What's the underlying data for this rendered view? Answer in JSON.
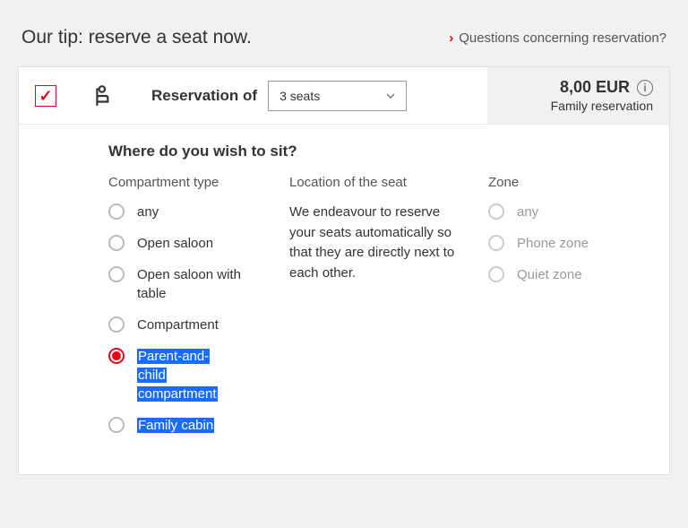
{
  "tip_title": "Our tip: reserve a seat now.",
  "help_link": "Questions concerning reservation?",
  "reservation_label": "Reservation of",
  "seats_select": {
    "value": "3 seats"
  },
  "price": "8,00 EUR",
  "price_sub": "Family reservation",
  "where_title": "Where do you wish to sit?",
  "columns": {
    "compartment_title": "Compartment type",
    "location_title": "Location of the seat",
    "zone_title": "Zone"
  },
  "location_text": "We endeavour to reserve your seats automatically so that they are directly next to each other.",
  "compartment_options": {
    "any": "any",
    "open_saloon": "Open saloon",
    "open_saloon_table": "Open saloon with table",
    "compartment": "Compartment",
    "parent_child_1": "Parent-and-",
    "parent_child_2": "child",
    "parent_child_3": "compartment",
    "family_cabin": "Family cabin"
  },
  "zone_options": {
    "any": "any",
    "phone": "Phone zone",
    "quiet": "Quiet zone"
  }
}
